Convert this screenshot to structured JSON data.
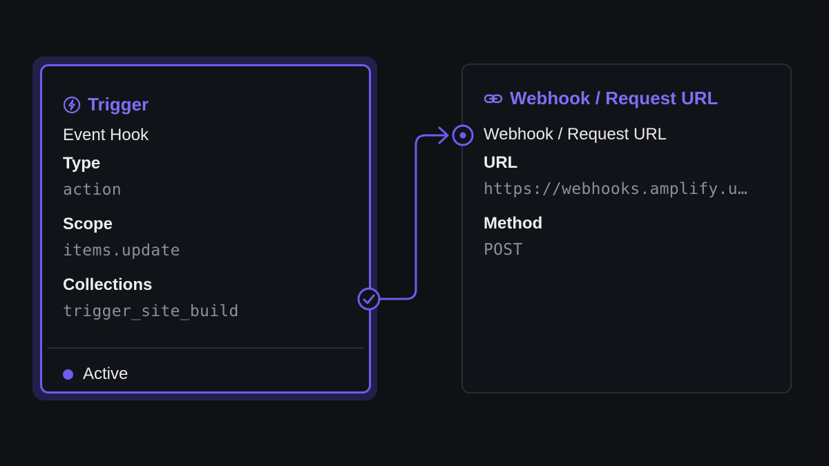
{
  "trigger": {
    "title": "Trigger",
    "icon": "bolt-icon",
    "subtitle": "Event Hook",
    "fields": [
      {
        "label": "Type",
        "value": "action"
      },
      {
        "label": "Scope",
        "value": "items.update"
      },
      {
        "label": "Collections",
        "value": "trigger_site_build"
      }
    ],
    "status": "Active"
  },
  "webhook": {
    "title": "Webhook / Request URL",
    "icon": "link-icon",
    "subtitle": "Webhook / Request URL",
    "fields": [
      {
        "label": "URL",
        "value": "https://webhooks.amplify.u…"
      },
      {
        "label": "Method",
        "value": "POST"
      }
    ]
  },
  "colors": {
    "accent": "#6f5cf0",
    "background": "#0f1115",
    "card_border": "#2a2d34"
  }
}
